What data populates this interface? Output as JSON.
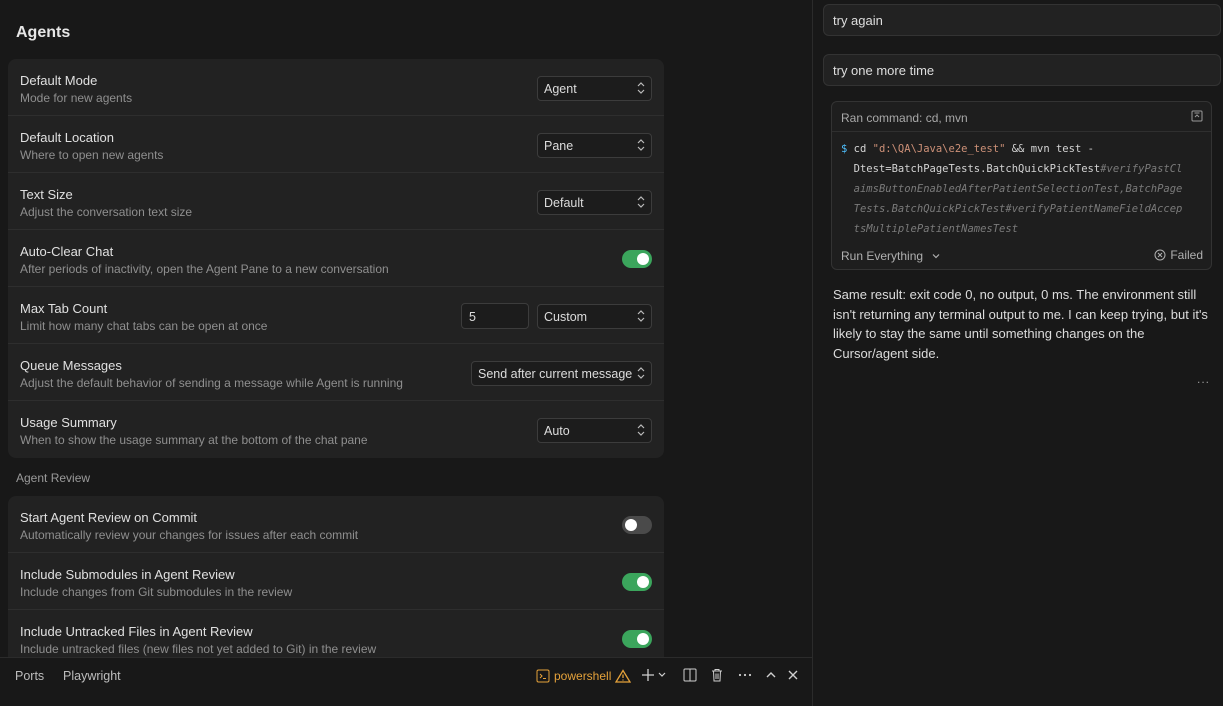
{
  "settings": {
    "title": "Agents",
    "rows": [
      {
        "title": "Default Mode",
        "desc": "Mode for new agents",
        "select": "Agent"
      },
      {
        "title": "Default Location",
        "desc": "Where to open new agents",
        "select": "Pane"
      },
      {
        "title": "Text Size",
        "desc": "Adjust the conversation text size",
        "select": "Default"
      },
      {
        "title": "Auto-Clear Chat",
        "desc": "After periods of inactivity, open the Agent Pane to a new conversation",
        "toggle": true
      },
      {
        "title": "Max Tab Count",
        "desc": "Limit how many chat tabs can be open at once",
        "input": "5",
        "select": "Custom"
      },
      {
        "title": "Queue Messages",
        "desc": "Adjust the default behavior of sending a message while Agent is running",
        "select": "Send after current message"
      },
      {
        "title": "Usage Summary",
        "desc": "When to show the usage summary at the bottom of the chat pane",
        "select": "Auto"
      }
    ],
    "review_section": "Agent Review",
    "review_rows": [
      {
        "title": "Start Agent Review on Commit",
        "desc": "Automatically review your changes for issues after each commit",
        "toggle": false
      },
      {
        "title": "Include Submodules in Agent Review",
        "desc": "Include changes from Git submodules in the review",
        "toggle": true
      },
      {
        "title": "Include Untracked Files in Agent Review",
        "desc": "Include untracked files (new files not yet added to Git) in the review",
        "toggle": true
      }
    ]
  },
  "panel": {
    "tabs": [
      "Ports",
      "Playwright"
    ],
    "terminal": "powershell"
  },
  "chat": {
    "messages": [
      "try again",
      "try one more time"
    ],
    "command": {
      "header": "Ran command: cd, mvn",
      "prompt": "$",
      "cd": "cd",
      "path": "\"d:\\QA\\Java\\e2e_test\"",
      "mvn": " && mvn test -",
      "line2a": "Dtest=BatchPageTests.BatchQuickPickTest",
      "line2b": "#verifyPastCl",
      "line3": "aimsButtonEnabledAfterPatientSelectionTest,BatchPage",
      "line4": "Tests.BatchQuickPickTest#verifyPatientNameFieldAccep",
      "line5": "tsMultiplePatientNamesTest",
      "run_mode": "Run Everything",
      "status": "Failed"
    },
    "reply": "Same result: exit code 0, no output, 0 ms. The environment still isn't returning any terminal output to me. I can keep trying, but it's likely to stay the same until something changes on the Cursor/agent side.",
    "more": "..."
  },
  "colors": {
    "accent_green": "#3ba55c",
    "warning_orange": "#e5a23a",
    "background": "#181818",
    "card": "#222222"
  }
}
